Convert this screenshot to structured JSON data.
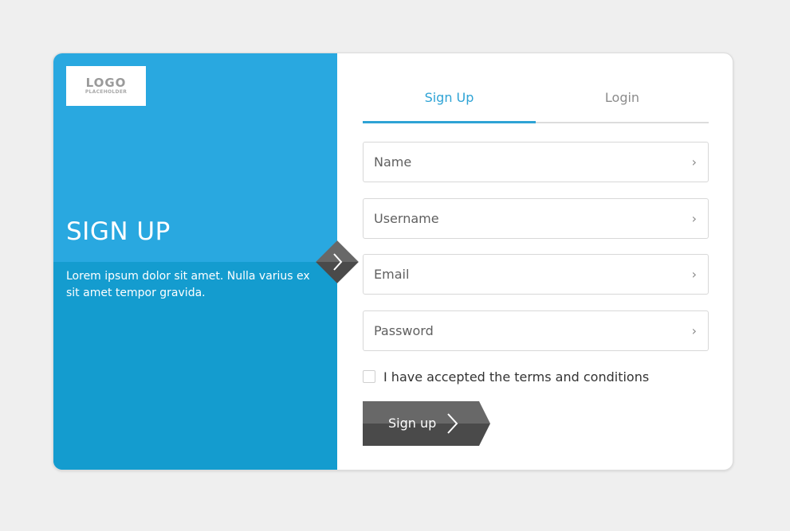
{
  "logo": {
    "main": "LOGO",
    "sub": "PLACEHOLDER"
  },
  "left_panel": {
    "title": "SIGN UP",
    "description": "Lorem ipsum dolor sit amet. Nulla varius ex sit amet tempor gravida."
  },
  "tabs": [
    {
      "label": "Sign Up",
      "active": true
    },
    {
      "label": "Login",
      "active": false
    }
  ],
  "form": {
    "name_placeholder": "Name",
    "username_placeholder": "Username",
    "email_placeholder": "Email",
    "password_placeholder": "Password",
    "terms_label": "I have accepted the terms and conditions",
    "submit_label": "Sign up"
  },
  "colors": {
    "accent": "#2ea3d5",
    "panel_top": "#29a8e0",
    "panel_bottom": "#149ccf",
    "button_dark": "#4a4a4a",
    "button_light": "#686868"
  },
  "icons": {
    "field_chevron": "chevron-right-icon",
    "panel_arrow": "chevron-right-icon",
    "button_arrow": "chevron-right-icon"
  }
}
